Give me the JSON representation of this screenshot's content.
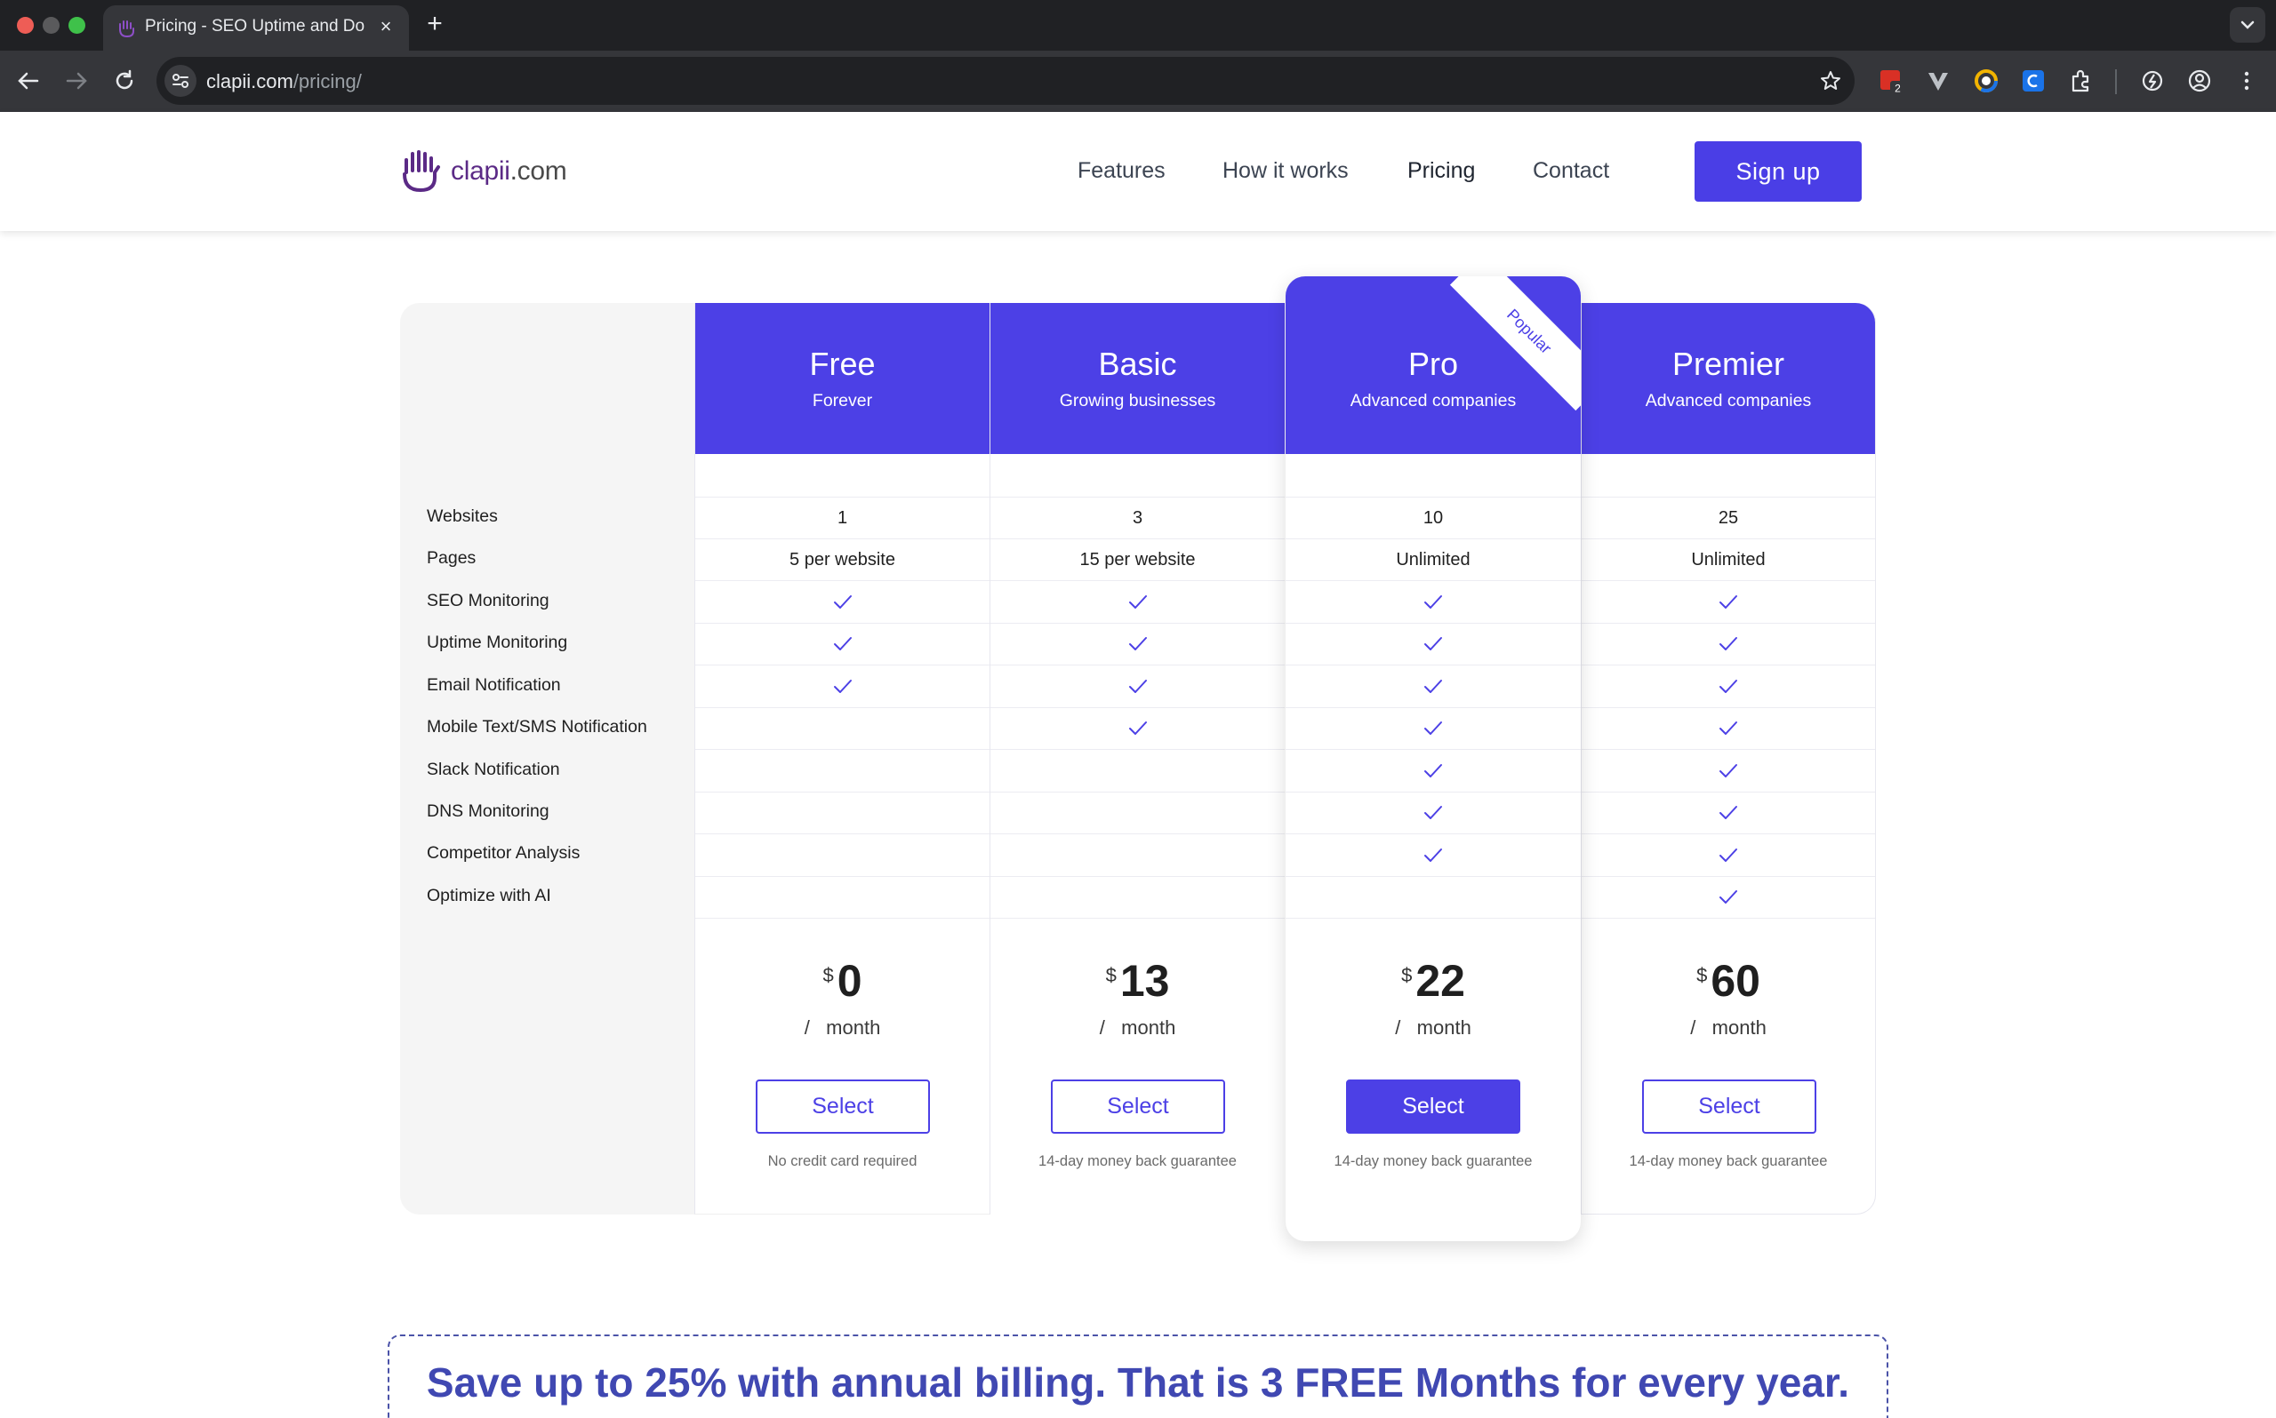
{
  "browser": {
    "tab_title": "Pricing - SEO Uptime and Do",
    "tab_close": "×",
    "new_tab": "+",
    "url_host": "clapii.com",
    "url_path": "/pricing/",
    "extension_badge": "2"
  },
  "site": {
    "logo_text": "clapii",
    "logo_domain": ".com",
    "nav": [
      "Features",
      "How it works",
      "Pricing",
      "Contact"
    ],
    "active_nav": "Pricing",
    "signup_label": "Sign up"
  },
  "pricing": {
    "features": [
      "Websites",
      "Pages",
      "SEO Monitoring",
      "Uptime Monitoring",
      "Email Notification",
      "Mobile Text/SMS Notification",
      "Slack Notification",
      "DNS Monitoring",
      "Competitor Analysis",
      "Optimize with AI"
    ],
    "currency": "$",
    "per_label": "month",
    "per_slash": "/",
    "select_label": "Select",
    "popular_label": "Popular",
    "accent_color": "#4c40e6",
    "plans": [
      {
        "name": "Free",
        "subtitle": "Forever",
        "websites": "1",
        "pages": "5 per website",
        "checks": [
          true,
          true,
          true,
          false,
          false,
          false,
          false,
          false
        ],
        "price": "0",
        "note": "No credit card required"
      },
      {
        "name": "Basic",
        "subtitle": "Growing businesses",
        "websites": "3",
        "pages": "15 per website",
        "checks": [
          true,
          true,
          true,
          true,
          false,
          false,
          false,
          false
        ],
        "price": "13",
        "note": "14-day money back guarantee"
      },
      {
        "name": "Pro",
        "subtitle": "Advanced companies",
        "websites": "10",
        "pages": "Unlimited",
        "checks": [
          true,
          true,
          true,
          true,
          true,
          true,
          true,
          false
        ],
        "price": "22",
        "note": "14-day money back guarantee",
        "popular": true
      },
      {
        "name": "Premier",
        "subtitle": "Advanced companies",
        "websites": "25",
        "pages": "Unlimited",
        "checks": [
          true,
          true,
          true,
          true,
          true,
          true,
          true,
          true
        ],
        "price": "60",
        "note": "14-day money back guarantee"
      }
    ]
  },
  "annual_banner": "Save up to 25% with annual billing. That is 3 FREE Months for every year."
}
